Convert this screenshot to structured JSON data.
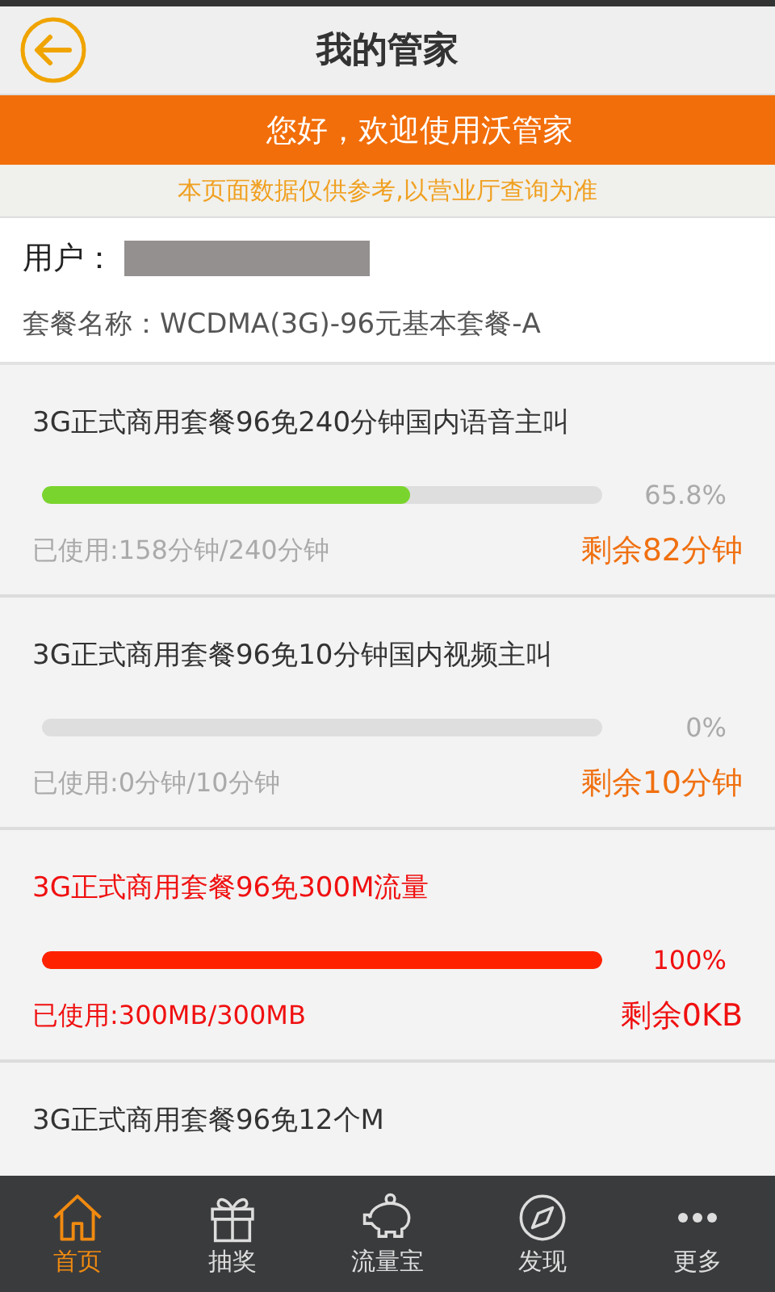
{
  "header": {
    "title": "我的管家"
  },
  "banner": {
    "text": "您好，欢迎使用沃管家"
  },
  "notice": {
    "text": "本页面数据仅供参考,以营业厅查询为准"
  },
  "account": {
    "user_label": "用户：",
    "plan": "套餐名称：WCDMA(3G)-96元基本套餐-A"
  },
  "packages": [
    {
      "title": "3G正式商用套餐96免240分钟国内语音主叫",
      "exhausted": false,
      "level": 0.658,
      "percent": "65.8%",
      "used": "已使用:158分钟/240分钟",
      "remaining": "剩余82分钟"
    },
    {
      "title": "3G正式商用套餐96免10分钟国内视频主叫",
      "exhausted": false,
      "level": 0,
      "percent": "0%",
      "used": "已使用:0分钟/10分钟",
      "remaining": "剩余10分钟"
    },
    {
      "title": "3G正式商用套餐96免300M流量",
      "exhausted": true,
      "level": 1,
      "percent": "100%",
      "used": "已使用:300MB/300MB",
      "remaining": "剩余0KB"
    },
    {
      "title": "3G正式商用套餐96免12个M"
    }
  ],
  "nav": [
    {
      "kind": "home",
      "label": "首页",
      "selected": true
    },
    {
      "kind": "gift",
      "label": "抽奖",
      "selected": false
    },
    {
      "kind": "piggy",
      "label": "流量宝",
      "selected": false
    },
    {
      "kind": "compass",
      "label": "发现",
      "selected": false
    },
    {
      "kind": "more",
      "label": "更多",
      "selected": false
    }
  ]
}
